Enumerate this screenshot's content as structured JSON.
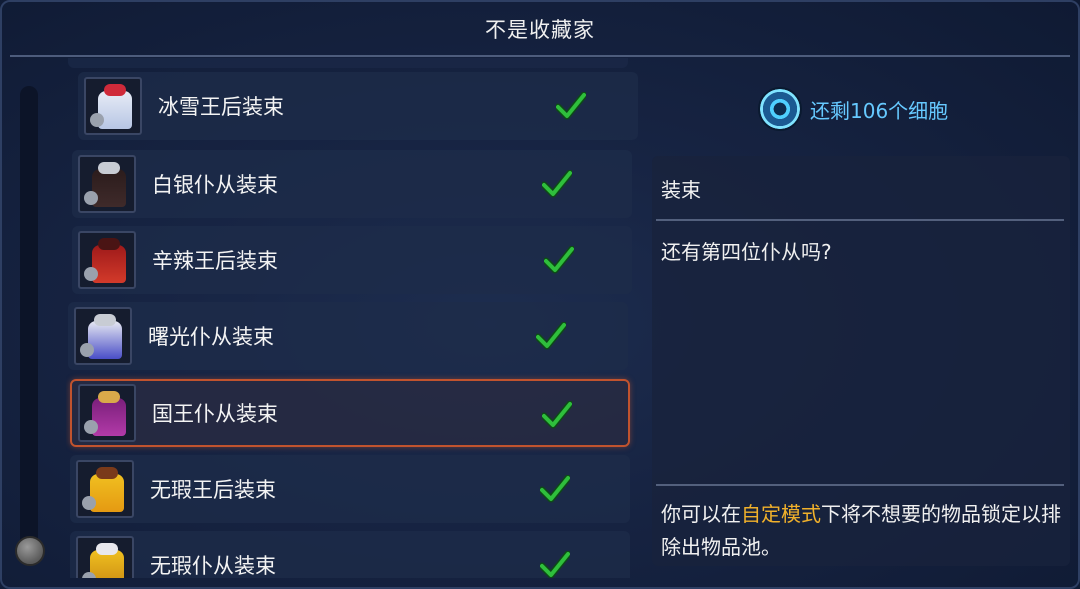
{
  "window": {
    "title": "不是收藏家"
  },
  "outfits": [
    {
      "name": "冰雪王后装束",
      "unlocked": true,
      "icon": "ice-queen-outfit-icon",
      "colors": [
        "#e7ecf6",
        "#b7c6e4",
        "#cf2a3a"
      ]
    },
    {
      "name": "白银仆从装束",
      "unlocked": true,
      "icon": "silver-servant-outfit-icon",
      "colors": [
        "#2b1c1c",
        "#3f2a2a",
        "#c8ccd4"
      ]
    },
    {
      "name": "辛辣王后装束",
      "unlocked": true,
      "icon": "spicy-queen-outfit-icon",
      "colors": [
        "#9e1a1a",
        "#d33a2a",
        "#4a1414"
      ]
    },
    {
      "name": "曙光仆从装束",
      "unlocked": true,
      "icon": "dawn-servant-outfit-icon",
      "colors": [
        "#e6e8f2",
        "#4a4ec7",
        "#c8ccd4"
      ]
    },
    {
      "name": "国王仆从装束",
      "unlocked": true,
      "icon": "king-servant-outfit-icon",
      "colors": [
        "#7a1f7a",
        "#b23aa8",
        "#d9a94a"
      ],
      "selected": true
    },
    {
      "name": "无瑕王后装束",
      "unlocked": true,
      "icon": "flawless-queen-outfit-icon",
      "colors": [
        "#f0c020",
        "#e59a12",
        "#7a3a1a"
      ]
    },
    {
      "name": "无瑕仆从装束",
      "unlocked": true,
      "icon": "flawless-servant-outfit-icon",
      "colors": [
        "#f0c020",
        "#c98a12",
        "#e8e8ee"
      ]
    }
  ],
  "cells": {
    "text": "还剩106个细胞",
    "icon": "cell-icon"
  },
  "details": {
    "category": "装束",
    "description": "还有第四位仆从吗?",
    "hint_before": "你可以在",
    "hint_highlight": "自定模式",
    "hint_after": "下将不想要的物品锁定以排除出物品池。"
  },
  "theme": {
    "accent_check": "#2fbf3c",
    "selection_border": "#c1532e",
    "cells_color": "#66c9ff",
    "hint_highlight": "#f1b12b"
  }
}
